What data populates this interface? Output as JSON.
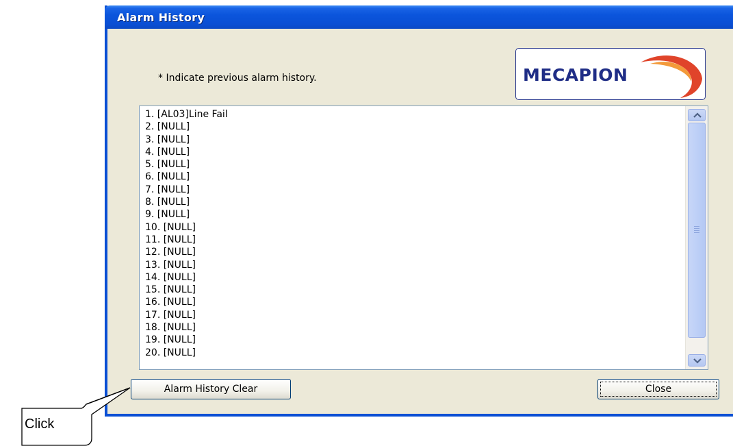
{
  "window": {
    "title": "Alarm History"
  },
  "instruction": "* Indicate previous alarm history.",
  "logo": {
    "text": "MECAPION",
    "accent_color": "#d9341f",
    "brand_color": "#1f2d86"
  },
  "alarm_list": [
    "1. [AL03]Line Fail",
    "2. [NULL]",
    "3. [NULL]",
    "4. [NULL]",
    "5. [NULL]",
    "6. [NULL]",
    "7. [NULL]",
    "8. [NULL]",
    "9. [NULL]",
    "10. [NULL]",
    "11. [NULL]",
    "12. [NULL]",
    "13. [NULL]",
    "14. [NULL]",
    "15. [NULL]",
    "16. [NULL]",
    "17. [NULL]",
    "18. [NULL]",
    "19. [NULL]",
    "20. [NULL]"
  ],
  "buttons": {
    "clear_label": "Alarm History Clear",
    "close_label": "Close"
  },
  "callout": {
    "text": "Click"
  },
  "icons": {
    "scroll_up": "chevron-up-icon",
    "scroll_down": "chevron-down-icon"
  }
}
